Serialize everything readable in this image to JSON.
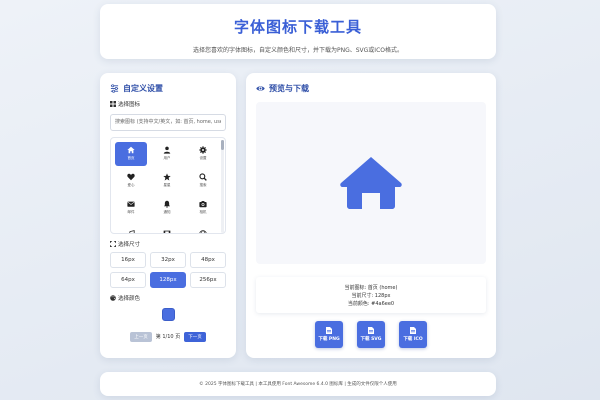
{
  "header": {
    "title": "字体图标下载工具",
    "subtitle": "选择您喜欢的字体图标，自定义颜色和尺寸，并下载为PNG、SVG或ICO格式。"
  },
  "left_panel": {
    "title": "自定义设置",
    "select_icon_label": "选择图标",
    "search_placeholder": "搜索图标 (支持中文/英文，如: 首页, home, user)",
    "icons": [
      {
        "name": "home-icon",
        "label": "首页",
        "selected": true
      },
      {
        "name": "user-icon",
        "label": "用户",
        "selected": false
      },
      {
        "name": "gear-icon",
        "label": "设置",
        "selected": false
      },
      {
        "name": "heart-icon",
        "label": "爱心",
        "selected": false
      },
      {
        "name": "star-icon",
        "label": "星星",
        "selected": false
      },
      {
        "name": "search-icon",
        "label": "搜索",
        "selected": false
      },
      {
        "name": "envelope-icon",
        "label": "邮件",
        "selected": false
      },
      {
        "name": "bell-icon",
        "label": "通知",
        "selected": false
      },
      {
        "name": "camera-icon",
        "label": "相机",
        "selected": false
      },
      {
        "name": "music-icon",
        "label": "",
        "selected": false
      },
      {
        "name": "film-icon",
        "label": "",
        "selected": false
      },
      {
        "name": "globe-icon",
        "label": "",
        "selected": false
      }
    ],
    "size_label": "选择尺寸",
    "sizes": [
      "16px",
      "32px",
      "48px",
      "64px",
      "128px",
      "256px"
    ],
    "selected_size": "128px",
    "color_label": "选择颜色",
    "selected_color": "#4a6ee0",
    "pagination": {
      "prev_label": "上一页",
      "info": "第 1/10 页",
      "next_label": "下一页"
    }
  },
  "right_panel": {
    "title": "预览与下载",
    "info": {
      "current_icon": "当前图标: 首页 (home)",
      "current_size": "当前尺寸: 128px",
      "current_color": "当前颜色: #4a6ee0"
    },
    "downloads": [
      {
        "label": "下载 PNG"
      },
      {
        "label": "下载 SVG"
      },
      {
        "label": "下载 ICO"
      }
    ]
  },
  "footer": {
    "text": "© 2025 字体图标下载工具 | 本工具使用 Font Awesome 6.4.0 图标库 | 生成的文件仅限个人使用"
  },
  "colors": {
    "accent": "#4a6ee0",
    "title": "#3a5fd6",
    "background": "#e8edf4"
  }
}
